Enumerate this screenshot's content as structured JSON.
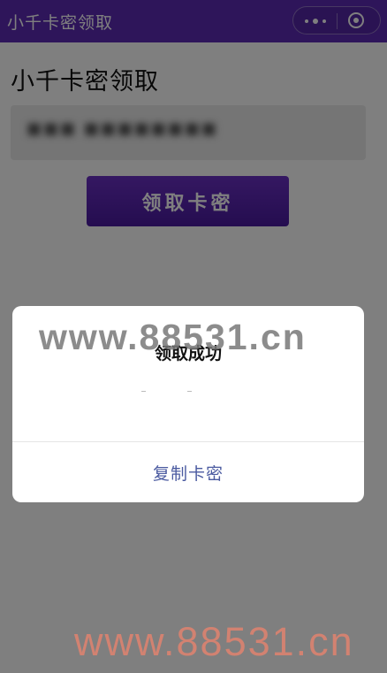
{
  "navbar": {
    "title": "小千卡密领取",
    "menu_icon": "more-dots-icon",
    "close_icon": "close-circle-icon"
  },
  "main": {
    "heading": "小千卡密领取",
    "code_value": "■■■ ■■■■■■■■",
    "claim_button": "领取卡密"
  },
  "dialog": {
    "title": "领取成功",
    "action": "复制卡密"
  },
  "watermarks": {
    "middle": "www.88531.cn",
    "bottom": "www.88531.cn"
  },
  "colors": {
    "navbar": "#5c2bb5",
    "button": "#5a22b0",
    "dialog_action": "#4a5aa0"
  }
}
